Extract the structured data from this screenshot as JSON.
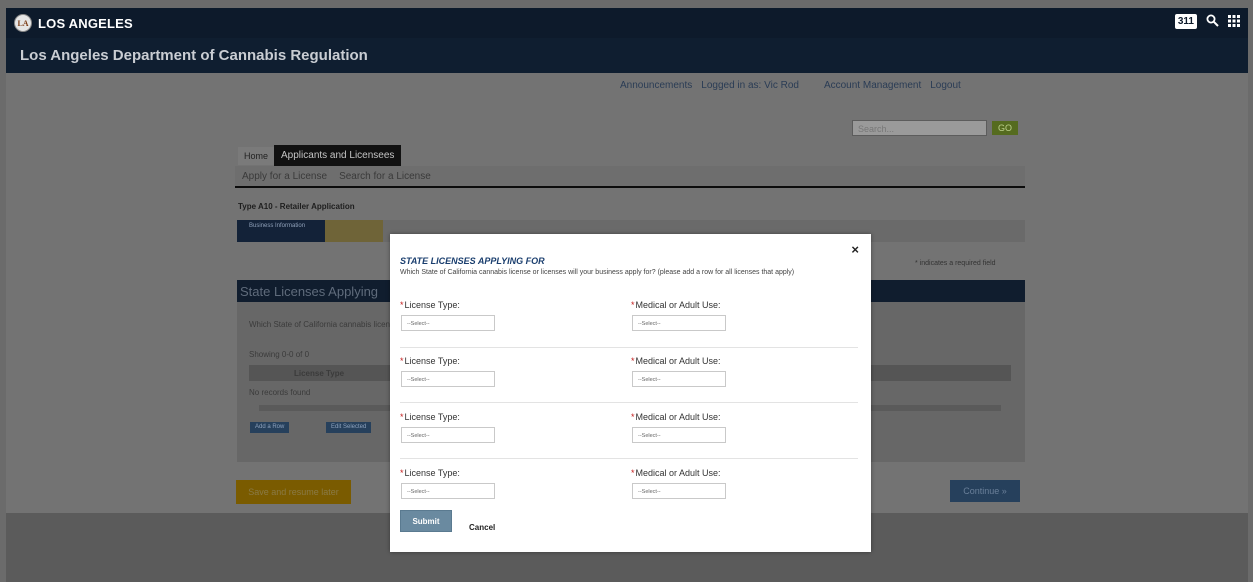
{
  "city_bar": {
    "seal_text": "LA",
    "name": "LOS ANGELES",
    "badge_311": "311"
  },
  "dept": {
    "title": "Los Angeles Department of Cannabis Regulation"
  },
  "top_links": {
    "announcements": "Announcements",
    "logged_in": "Logged in as: Vic Rod",
    "account": "Account Management",
    "logout": "Logout"
  },
  "search": {
    "placeholder": "Search...",
    "go": "GO"
  },
  "nav": {
    "home": "Home",
    "active_tab": "Applicants and Licensees",
    "sub_apply": "Apply for a License",
    "sub_search": "Search for a License"
  },
  "app": {
    "type_label": "Type A10 - Retailer Application",
    "step1": "Business Information",
    "required_note": "* indicates a required field",
    "panel_title": "State Licenses Applying",
    "body_text": "Which State of California cannabis license",
    "showing": "Showing 0-0 of 0",
    "col_license_type": "License Type",
    "no_records": "No records found",
    "add_row": "Add a Row",
    "edit_selected": "Edit Selected",
    "save_resume": "Save and resume later",
    "continue": "Continue »"
  },
  "modal": {
    "close": "×",
    "title": "STATE LICENSES APPLYING FOR",
    "description": "Which State of California cannabis license or licenses will your business apply for? (please add a row for all licenses that apply)",
    "required_mark": "*",
    "rows": [
      {
        "license_label": "License Type:",
        "license_value": "--Select--",
        "use_label": "Medical or Adult Use:",
        "use_value": "--Select--"
      },
      {
        "license_label": "License Type:",
        "license_value": "--Select--",
        "use_label": "Medical or Adult Use:",
        "use_value": "--Select--"
      },
      {
        "license_label": "License Type:",
        "license_value": "--Select--",
        "use_label": "Medical or Adult Use:",
        "use_value": "--Select--"
      },
      {
        "license_label": "License Type:",
        "license_value": "--Select--",
        "use_label": "Medical or Adult Use:",
        "use_value": "--Select--"
      }
    ],
    "submit": "Submit",
    "cancel": "Cancel"
  },
  "colors": {
    "accent_blue": "#1a3e6e",
    "required_red": "#c41d1d",
    "submit_bg": "#6a8aa0"
  },
  "icons": {
    "search": "search-icon",
    "apps": "apps-grid-icon"
  }
}
